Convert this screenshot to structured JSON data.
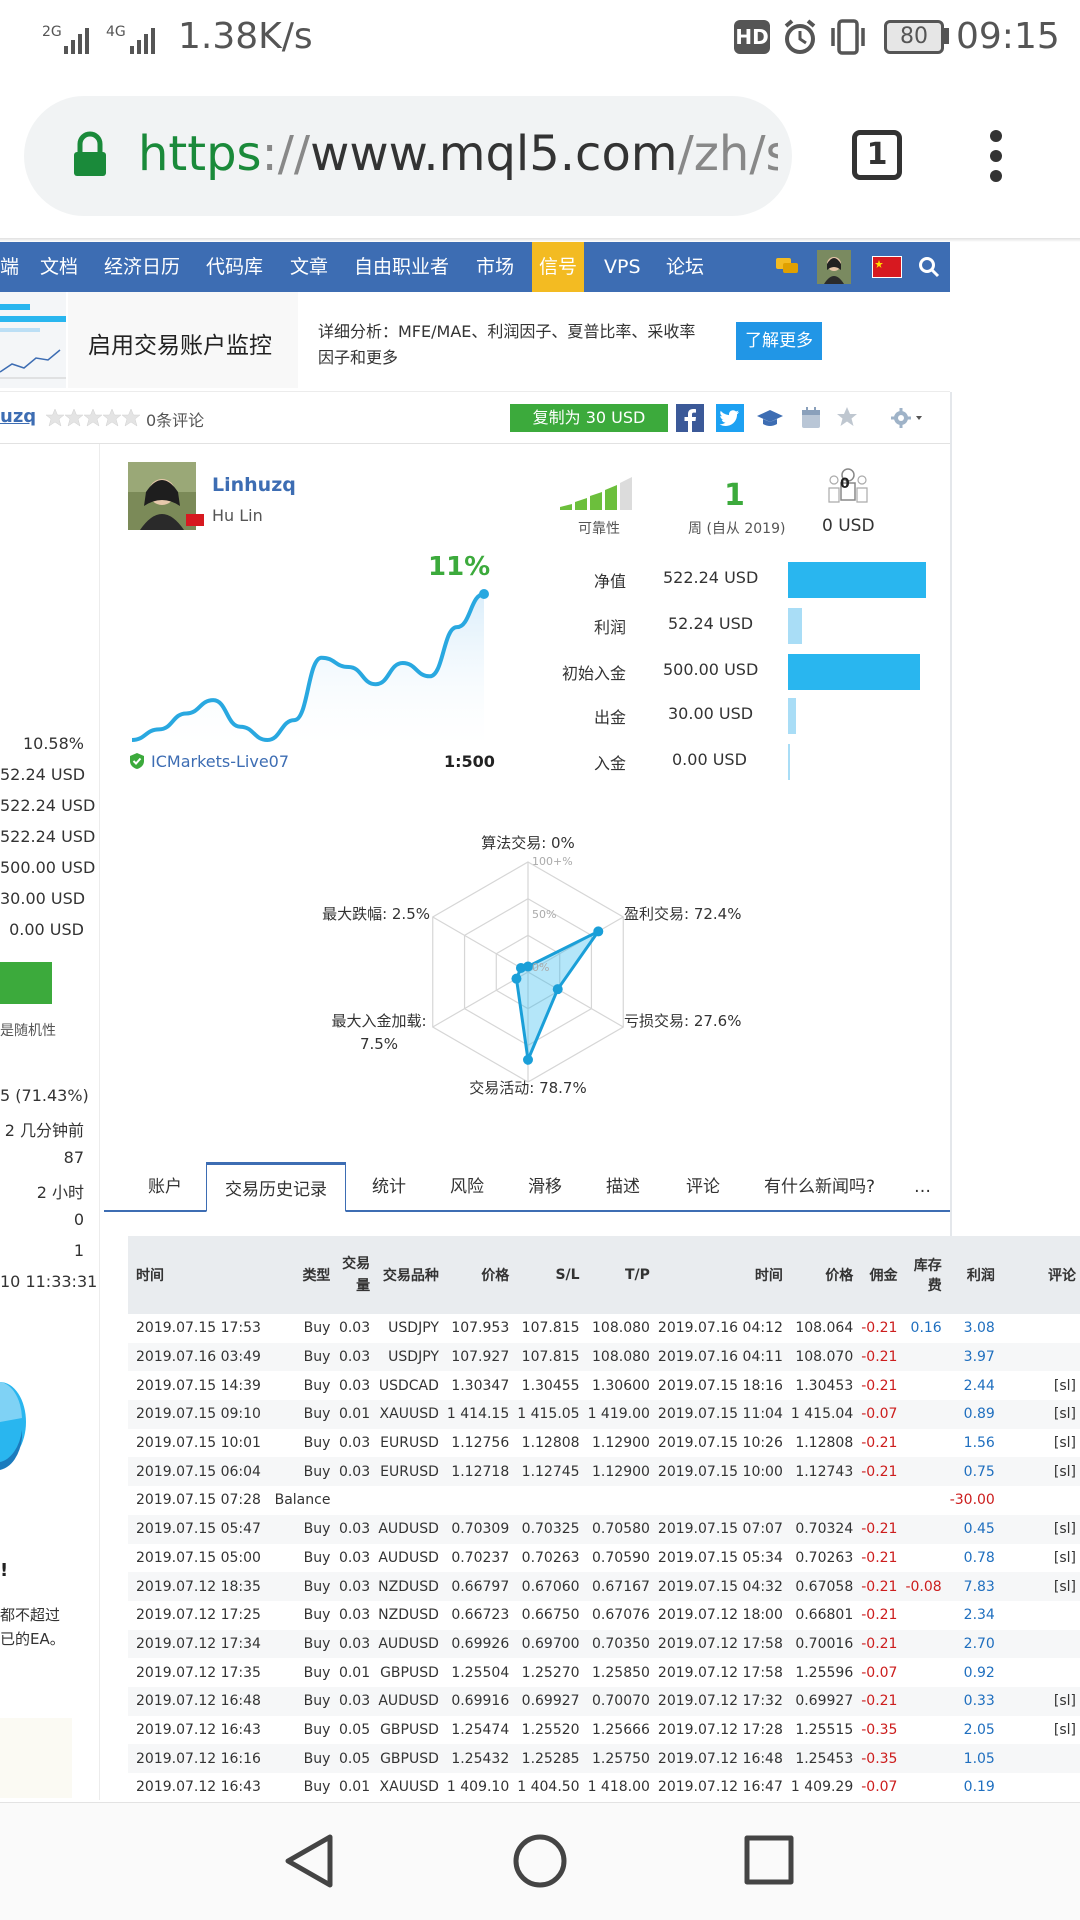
{
  "status_bar": {
    "network": "2G 4G",
    "speed": "1.38K/s",
    "hd": "HD",
    "battery": "80",
    "time": "09:15"
  },
  "browser": {
    "url_scheme": "https",
    "url_sep": "://",
    "url_host": "www.mql5.com",
    "url_path": "/zh/sig",
    "tab_count": "1"
  },
  "nav": {
    "items": [
      "端",
      "文档",
      "经济日历",
      "代码库",
      "文章",
      "自由职业者",
      "市场",
      "信号",
      "VPS",
      "论坛"
    ],
    "active": "信号"
  },
  "banner": {
    "title": "启用交易账户监控",
    "desc_line1": "详细分析：MFE/MAE、利润因子、夏普比率、采收率",
    "desc_line2": "因子和更多",
    "button": "了解更多"
  },
  "signal_header": {
    "name_partial": "uzq",
    "reviews": "0条评论",
    "copy_button": "复制为 30 USD"
  },
  "profile": {
    "name": "Linhuzq",
    "real_name": "Hu Lin",
    "reliability_label": "可靠性",
    "weeks_value": "1",
    "weeks_label": "周 (自从 2019)",
    "subscribers": "0",
    "subscriber_price": "0 USD",
    "growth": "11%",
    "broker": "ICMarkets-Live07",
    "leverage": "1:500"
  },
  "account_stats": [
    {
      "label": "净值",
      "value": "522.24 USD",
      "fill": 1.0
    },
    {
      "label": "利润",
      "value": "52.24 USD",
      "fill": 0.1
    },
    {
      "label": "初始入金",
      "value": "500.00 USD",
      "fill": 0.957
    },
    {
      "label": "出金",
      "value": "30.00 USD",
      "fill": 0.057
    },
    {
      "label": "入金",
      "value": "0.00 USD",
      "fill": 0.0
    }
  ],
  "growth_chart": {
    "values": [
      0.0,
      0.8,
      2.0,
      3.0,
      1.0,
      0.0,
      1.5,
      6.2,
      5.5,
      4.2,
      5.8,
      4.8,
      8.5,
      11.0
    ]
  },
  "radar": {
    "scale_labels": [
      "100+%",
      "50%",
      "0%"
    ],
    "axes": [
      {
        "label": "算法交易: 0%",
        "value": 0.0
      },
      {
        "label": "盈利交易: 72.4%",
        "value": 72.4
      },
      {
        "label": "亏损交易: 27.6%",
        "value": 27.6
      },
      {
        "label": "交易活动: 78.7%",
        "value": 78.7
      },
      {
        "label": "最大入金加载:",
        "label2": "7.5%",
        "value": 7.5
      },
      {
        "label": "最大跌幅: 2.5%",
        "value": 2.5
      }
    ]
  },
  "left_column": {
    "values": [
      "10.58%",
      "52.24 USD",
      "522.24 USD",
      "522.24 USD",
      "500.00 USD",
      "30.00 USD",
      "0.00 USD"
    ],
    "random_note": "是随机性",
    "values2": [
      "5 (71.43%)",
      "2 几分钟前",
      "87",
      "2 小时",
      "0",
      "1",
      "10 11:33:31"
    ],
    "warn_title": "!",
    "warn_line1": "都不超过",
    "warn_line2": "已的EA。"
  },
  "tabs": [
    "账户",
    "交易历史记录",
    "统计",
    "风险",
    "滑移",
    "描述",
    "评论",
    "有什么新闻吗?",
    "…"
  ],
  "active_tab": "交易历史记录",
  "trades": {
    "headers": [
      "时间",
      "类型",
      "交易量",
      "交易品种",
      "价格",
      "S/L",
      "T/P",
      "时间",
      "价格",
      "佣金",
      "库存费",
      "利润",
      "评论"
    ],
    "rows": [
      [
        "2019.07.15 17:53",
        "Buy",
        "0.03",
        "USDJPY",
        "107.953",
        "107.815",
        "108.080",
        "2019.07.16 04:12",
        "108.064",
        "-0.21",
        "0.16",
        "3.08",
        ""
      ],
      [
        "2019.07.16 03:49",
        "Buy",
        "0.03",
        "USDJPY",
        "107.927",
        "107.815",
        "108.080",
        "2019.07.16 04:11",
        "108.070",
        "-0.21",
        "",
        "3.97",
        ""
      ],
      [
        "2019.07.15 14:39",
        "Buy",
        "0.03",
        "USDCAD",
        "1.30347",
        "1.30455",
        "1.30600",
        "2019.07.15 18:16",
        "1.30453",
        "-0.21",
        "",
        "2.44",
        "[sl]"
      ],
      [
        "2019.07.15 09:10",
        "Buy",
        "0.01",
        "XAUUSD",
        "1 414.15",
        "1 415.05",
        "1 419.00",
        "2019.07.15 11:04",
        "1 415.04",
        "-0.07",
        "",
        "0.89",
        "[sl]"
      ],
      [
        "2019.07.15 10:01",
        "Buy",
        "0.03",
        "EURUSD",
        "1.12756",
        "1.12808",
        "1.12900",
        "2019.07.15 10:26",
        "1.12808",
        "-0.21",
        "",
        "1.56",
        "[sl]"
      ],
      [
        "2019.07.15 06:04",
        "Buy",
        "0.03",
        "EURUSD",
        "1.12718",
        "1.12745",
        "1.12900",
        "2019.07.15 10:00",
        "1.12743",
        "-0.21",
        "",
        "0.75",
        "[sl]"
      ],
      [
        "2019.07.15 07:28",
        "Balance",
        "",
        "",
        "",
        "",
        "",
        "",
        "",
        "",
        "",
        "-30.00",
        ""
      ],
      [
        "2019.07.15 05:47",
        "Buy",
        "0.03",
        "AUDUSD",
        "0.70309",
        "0.70325",
        "0.70580",
        "2019.07.15 07:07",
        "0.70324",
        "-0.21",
        "",
        "0.45",
        "[sl]"
      ],
      [
        "2019.07.15 05:00",
        "Buy",
        "0.03",
        "AUDUSD",
        "0.70237",
        "0.70263",
        "0.70590",
        "2019.07.15 05:34",
        "0.70263",
        "-0.21",
        "",
        "0.78",
        "[sl]"
      ],
      [
        "2019.07.12 18:35",
        "Buy",
        "0.03",
        "NZDUSD",
        "0.66797",
        "0.67060",
        "0.67167",
        "2019.07.15 04:32",
        "0.67058",
        "-0.21",
        "-0.08",
        "7.83",
        "[sl]"
      ],
      [
        "2019.07.12 17:25",
        "Buy",
        "0.03",
        "NZDUSD",
        "0.66723",
        "0.66750",
        "0.67076",
        "2019.07.12 18:00",
        "0.66801",
        "-0.21",
        "",
        "2.34",
        ""
      ],
      [
        "2019.07.12 17:34",
        "Buy",
        "0.03",
        "AUDUSD",
        "0.69926",
        "0.69700",
        "0.70350",
        "2019.07.12 17:58",
        "0.70016",
        "-0.21",
        "",
        "2.70",
        ""
      ],
      [
        "2019.07.12 17:35",
        "Buy",
        "0.01",
        "GBPUSD",
        "1.25504",
        "1.25270",
        "1.25850",
        "2019.07.12 17:58",
        "1.25596",
        "-0.07",
        "",
        "0.92",
        ""
      ],
      [
        "2019.07.12 16:48",
        "Buy",
        "0.03",
        "AUDUSD",
        "0.69916",
        "0.69927",
        "0.70070",
        "2019.07.12 17:32",
        "0.69927",
        "-0.21",
        "",
        "0.33",
        "[sl]"
      ],
      [
        "2019.07.12 16:43",
        "Buy",
        "0.05",
        "GBPUSD",
        "1.25474",
        "1.25520",
        "1.25666",
        "2019.07.12 17:28",
        "1.25515",
        "-0.35",
        "",
        "2.05",
        "[sl]"
      ],
      [
        "2019.07.12 16:16",
        "Buy",
        "0.05",
        "GBPUSD",
        "1.25432",
        "1.25285",
        "1.25750",
        "2019.07.12 16:48",
        "1.25453",
        "-0.35",
        "",
        "1.05",
        ""
      ],
      [
        "2019.07.12 16:43",
        "Buy",
        "0.01",
        "XAUUSD",
        "1 409.10",
        "1 404.50",
        "1 418.00",
        "2019.07.12 16:47",
        "1 409.29",
        "-0.07",
        "",
        "0.19",
        ""
      ]
    ]
  },
  "colors": {
    "nav_bg": "#3d6db3",
    "nav_active": "#f3bb22",
    "accent_blue": "#29b6ef",
    "green": "#3caa3c",
    "negative": "#cc1d1d",
    "positive": "#1f6fbf"
  }
}
